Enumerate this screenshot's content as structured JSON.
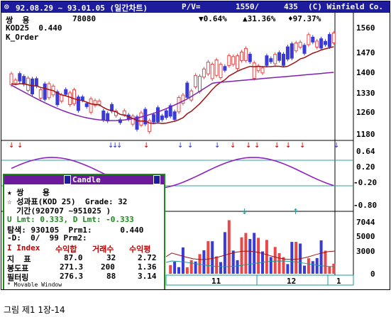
{
  "titlebar": {
    "app_icon": "circle-icon",
    "period": "92.08.29 ~ 93.01.05 (일간차트)",
    "pv_label": "P/V=",
    "pv_price": "1550/",
    "pv_volume": "435",
    "copyright": "(C) Winfield Co."
  },
  "header": {
    "name": "쌍  용",
    "price": "78080",
    "indicator": "KOD25  0.440",
    "order": "K_Order",
    "pct_down": "▼0.64%",
    "pct_up": "▲31.36%",
    "pct_total": "♦97.37%"
  },
  "price_axis": [
    "1560",
    "1470",
    "1400",
    "1330",
    "1260",
    "1180"
  ],
  "oscillator_axis": [
    "0.64",
    "0.20",
    "-0.20",
    "-0.80"
  ],
  "volume_axis": [
    "7044",
    "5000",
    "3000",
    "0"
  ],
  "months": [
    "11",
    "12",
    "1"
  ],
  "popup": {
    "title": "Candle",
    "name_row": "★ 쌍    용",
    "perf_row": "☆ 성과표(KOD 25)  Grade: 32",
    "period_row": "  기간(920707 ~951025 )",
    "lmt_row": "U Lmt: 0.333, D Lmt: -0.333",
    "search_row": "탐색: 930105  Prm1:      0.440",
    "d_row": "-D:  0/  99 Prm2:",
    "table_header": [
      "Index",
      "수익합",
      "거래수",
      "수익평"
    ],
    "table_rows": [
      [
        "지  표",
        "87.0",
        "32",
        "2.72"
      ],
      [
        "봉도표",
        "271.3",
        "200",
        "1.36"
      ],
      [
        "필터링",
        "276.3",
        "88",
        "3.14"
      ]
    ],
    "footer": "* Movable Window"
  },
  "caption": "그림 제1 1장-14",
  "colors": {
    "title_bg": "#1c1c9c",
    "candle_up": "#e84848",
    "candle_down": "#3a3ad8",
    "ma_short": "#a01010",
    "ma_long": "#8020b0",
    "osc": "#9020c0",
    "popup_border": "#1a8a1a"
  }
}
